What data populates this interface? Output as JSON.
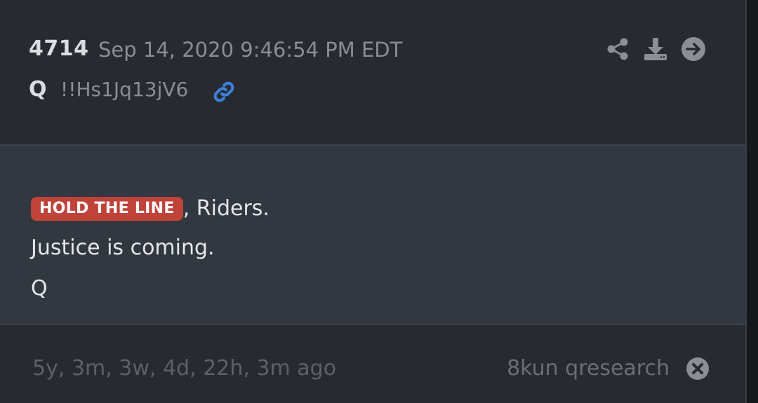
{
  "post": {
    "number": "4714",
    "timestamp": "Sep 14, 2020 9:46:54 PM EDT",
    "author": "Q",
    "tripcode": "!!Hs1Jq13jV6"
  },
  "toolbar": {
    "icons": [
      "share-icon",
      "download-icon",
      "arrow-right-circle-icon"
    ]
  },
  "message": {
    "tag": "HOLD THE LINE",
    "line1_suffix": ", Riders.",
    "line2": "Justice is coming.",
    "line3": "Q"
  },
  "footer": {
    "age": "5y, 3m, 3w, 4d, 22h, 3m ago",
    "source": "8kun qresearch"
  },
  "colors": {
    "tag_background": "#c0433a",
    "link_icon": "#3d7fd9",
    "header_background": "#272a31",
    "body_background": "#323840"
  }
}
